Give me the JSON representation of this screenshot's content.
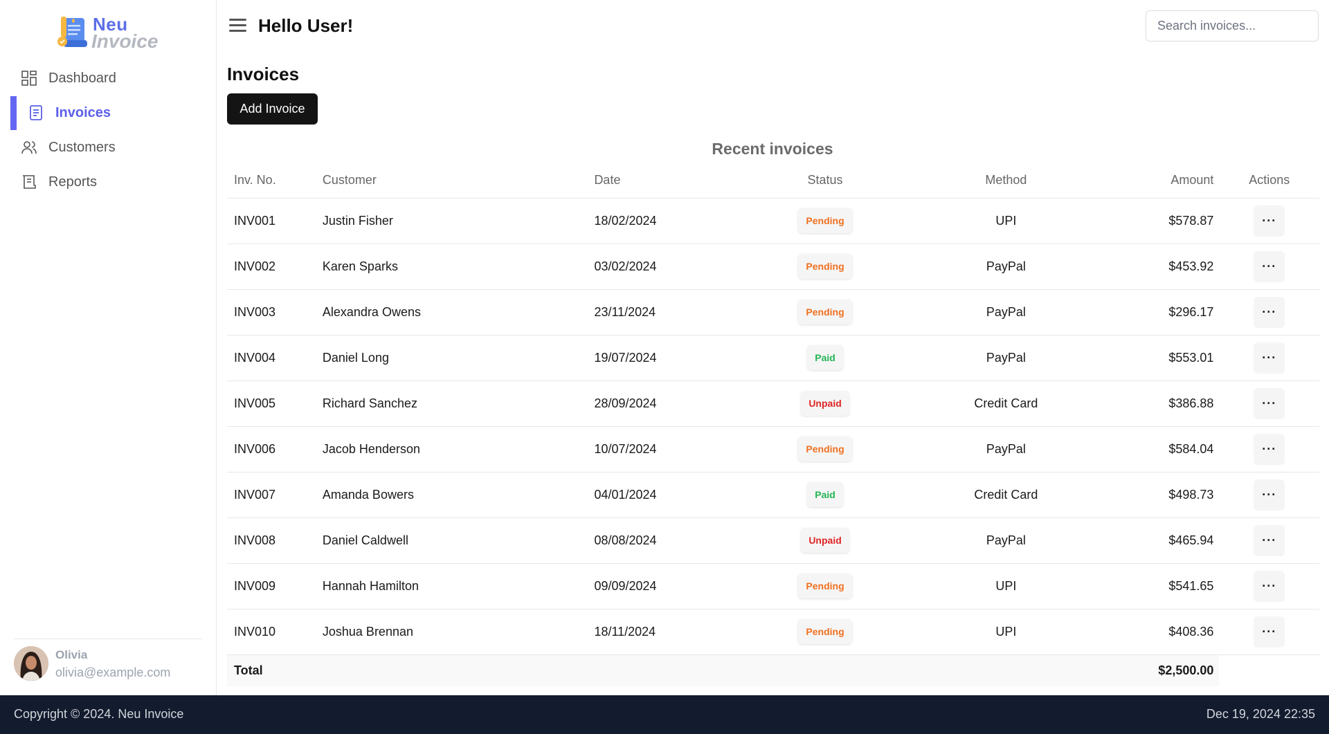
{
  "brand": {
    "line1": "Neu",
    "line2": "Invoice"
  },
  "sidebar": {
    "items": [
      {
        "label": "Dashboard",
        "icon": "dashboard-icon",
        "active": false
      },
      {
        "label": "Invoices",
        "icon": "invoice-icon",
        "active": true
      },
      {
        "label": "Customers",
        "icon": "users-icon",
        "active": false
      },
      {
        "label": "Reports",
        "icon": "reports-icon",
        "active": false
      }
    ],
    "user": {
      "name": "Olivia",
      "email": "olivia@example.com"
    }
  },
  "header": {
    "greeting": "Hello User!",
    "search_placeholder": "Search invoices..."
  },
  "main": {
    "title": "Invoices",
    "add_label": "Add Invoice",
    "caption": "Recent invoices",
    "columns": [
      "Inv. No.",
      "Customer",
      "Date",
      "Status",
      "Method",
      "Amount",
      "Actions"
    ],
    "rows": [
      {
        "no": "INV001",
        "customer": "Justin Fisher",
        "date": "18/02/2024",
        "status": "Pending",
        "method": "UPI",
        "amount": "$578.87"
      },
      {
        "no": "INV002",
        "customer": "Karen Sparks",
        "date": "03/02/2024",
        "status": "Pending",
        "method": "PayPal",
        "amount": "$453.92"
      },
      {
        "no": "INV003",
        "customer": "Alexandra Owens",
        "date": "23/11/2024",
        "status": "Pending",
        "method": "PayPal",
        "amount": "$296.17"
      },
      {
        "no": "INV004",
        "customer": "Daniel Long",
        "date": "19/07/2024",
        "status": "Paid",
        "method": "PayPal",
        "amount": "$553.01"
      },
      {
        "no": "INV005",
        "customer": "Richard Sanchez",
        "date": "28/09/2024",
        "status": "Unpaid",
        "method": "Credit Card",
        "amount": "$386.88"
      },
      {
        "no": "INV006",
        "customer": "Jacob Henderson",
        "date": "10/07/2024",
        "status": "Pending",
        "method": "PayPal",
        "amount": "$584.04"
      },
      {
        "no": "INV007",
        "customer": "Amanda Bowers",
        "date": "04/01/2024",
        "status": "Paid",
        "method": "Credit Card",
        "amount": "$498.73"
      },
      {
        "no": "INV008",
        "customer": "Daniel Caldwell",
        "date": "08/08/2024",
        "status": "Unpaid",
        "method": "PayPal",
        "amount": "$465.94"
      },
      {
        "no": "INV009",
        "customer": "Hannah Hamilton",
        "date": "09/09/2024",
        "status": "Pending",
        "method": "UPI",
        "amount": "$541.65"
      },
      {
        "no": "INV010",
        "customer": "Joshua Brennan",
        "date": "18/11/2024",
        "status": "Pending",
        "method": "UPI",
        "amount": "$408.36"
      }
    ],
    "actions_glyph": "···",
    "total_label": "Total",
    "total_amount": "$2,500.00"
  },
  "footer": {
    "copyright": "Copyright © 2024.  Neu Invoice",
    "datetime": "Dec 19, 2024 22:35"
  },
  "colors": {
    "accent": "#6366f1",
    "pending": "#f07020",
    "paid": "#22b454",
    "unpaid": "#e02424",
    "footer_bg": "#131b2e"
  }
}
